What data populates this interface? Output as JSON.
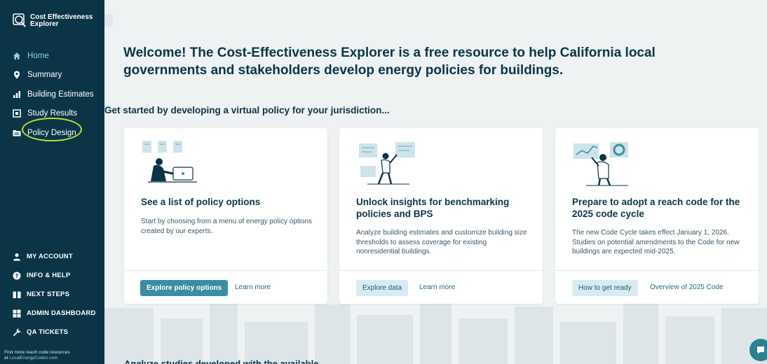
{
  "sidebar": {
    "logo_line1": "Cost Effectiveness",
    "logo_line2": "Explorer",
    "nav": [
      {
        "label": "Home",
        "icon": "home-icon"
      },
      {
        "label": "Summary",
        "icon": "map-pin-icon"
      },
      {
        "label": "Building Estimates",
        "icon": "bar-chart-icon"
      },
      {
        "label": "Study Results",
        "icon": "study-results-icon"
      },
      {
        "label": "Policy Design",
        "icon": "folder-icon"
      }
    ],
    "bottom_nav": [
      {
        "label": "MY ACCOUNT",
        "icon": "user-icon"
      },
      {
        "label": "INFO & HELP",
        "icon": "help-icon"
      },
      {
        "label": "NEXT STEPS",
        "icon": "book-icon"
      },
      {
        "label": "ADMIN DASHBOARD",
        "icon": "dashboard-icon"
      },
      {
        "label": "QA TICKETS",
        "icon": "wrench-icon"
      }
    ],
    "footer_line1": "Find more reach code resources",
    "footer_prefix": "at ",
    "footer_link": "LocalEnergyCodes.com"
  },
  "main": {
    "title": "Welcome! The Cost-Effectiveness Explorer is a free resource to help California local governments and stakeholders develop energy policies for buildings.",
    "section_title": "Get started by developing a virtual policy for your jurisdiction...",
    "cards": [
      {
        "title": "See a list of policy options",
        "description": "Start by choosing from a menu of energy policy options created by our experts.",
        "button": "Explore policy options",
        "link": "Learn more"
      },
      {
        "title": "Unlock insights for benchmarking policies and BPS",
        "description": "Analyze building estimates and customize building size thresholds to assess coverage for existing nonresidential buildings.",
        "button": "Explore data",
        "link": "Learn more"
      },
      {
        "title": "Prepare to adopt a reach code for the 2025 code cycle",
        "description": "The new Code Cycle takes effect January 1, 2026. Studies on potential amendments to the Code for new buildings are expected mid-2025.",
        "button": "How to get ready",
        "link": "Overview of 2025 Code"
      }
    ],
    "bottom_heading": "Analyze studies developed with the available..."
  },
  "colors": {
    "sidebar_bg": "#0b3547",
    "primary": "#3a8ea3",
    "highlight": "#b6e33b",
    "active_nav": "#8fd0e0"
  }
}
